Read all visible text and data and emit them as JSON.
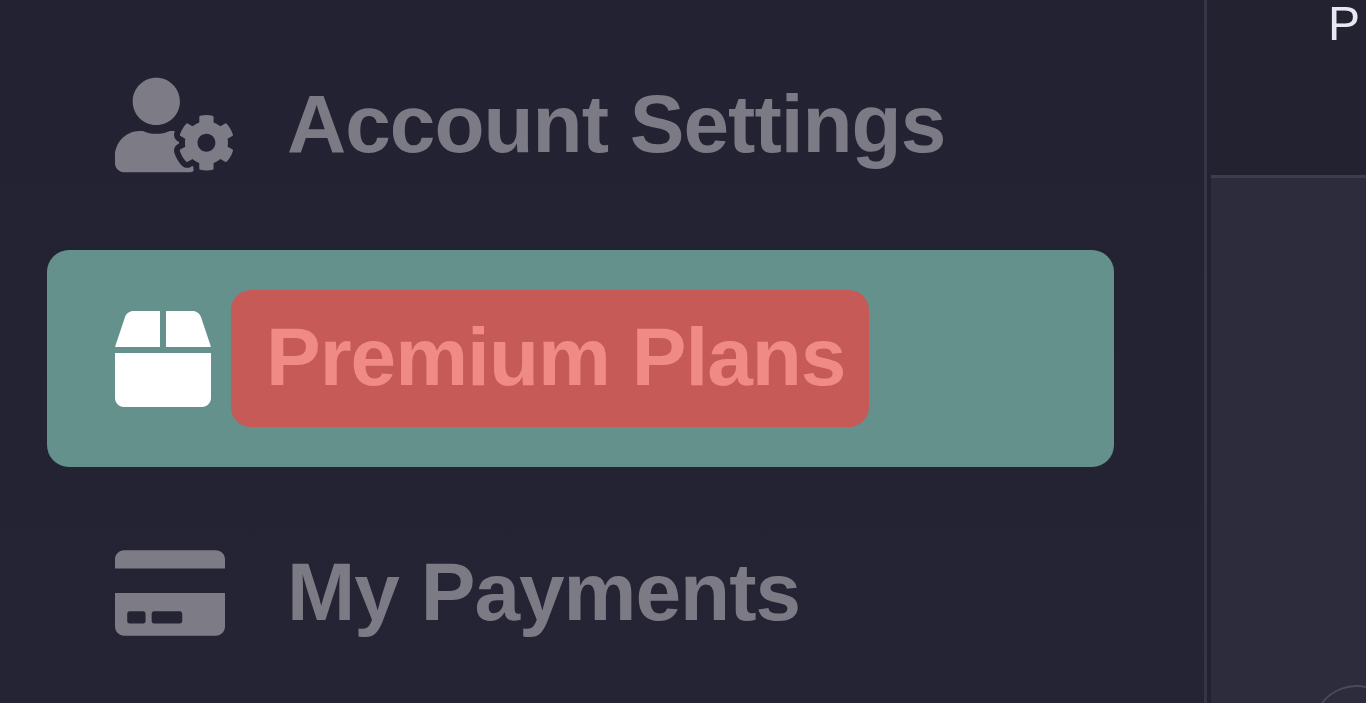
{
  "sidebar": {
    "items": [
      {
        "label": "Account Settings",
        "selected": false
      },
      {
        "label": "Premium Plans",
        "selected": true
      },
      {
        "label": "My Payments",
        "selected": false
      }
    ]
  },
  "header": {
    "title": "P"
  }
}
